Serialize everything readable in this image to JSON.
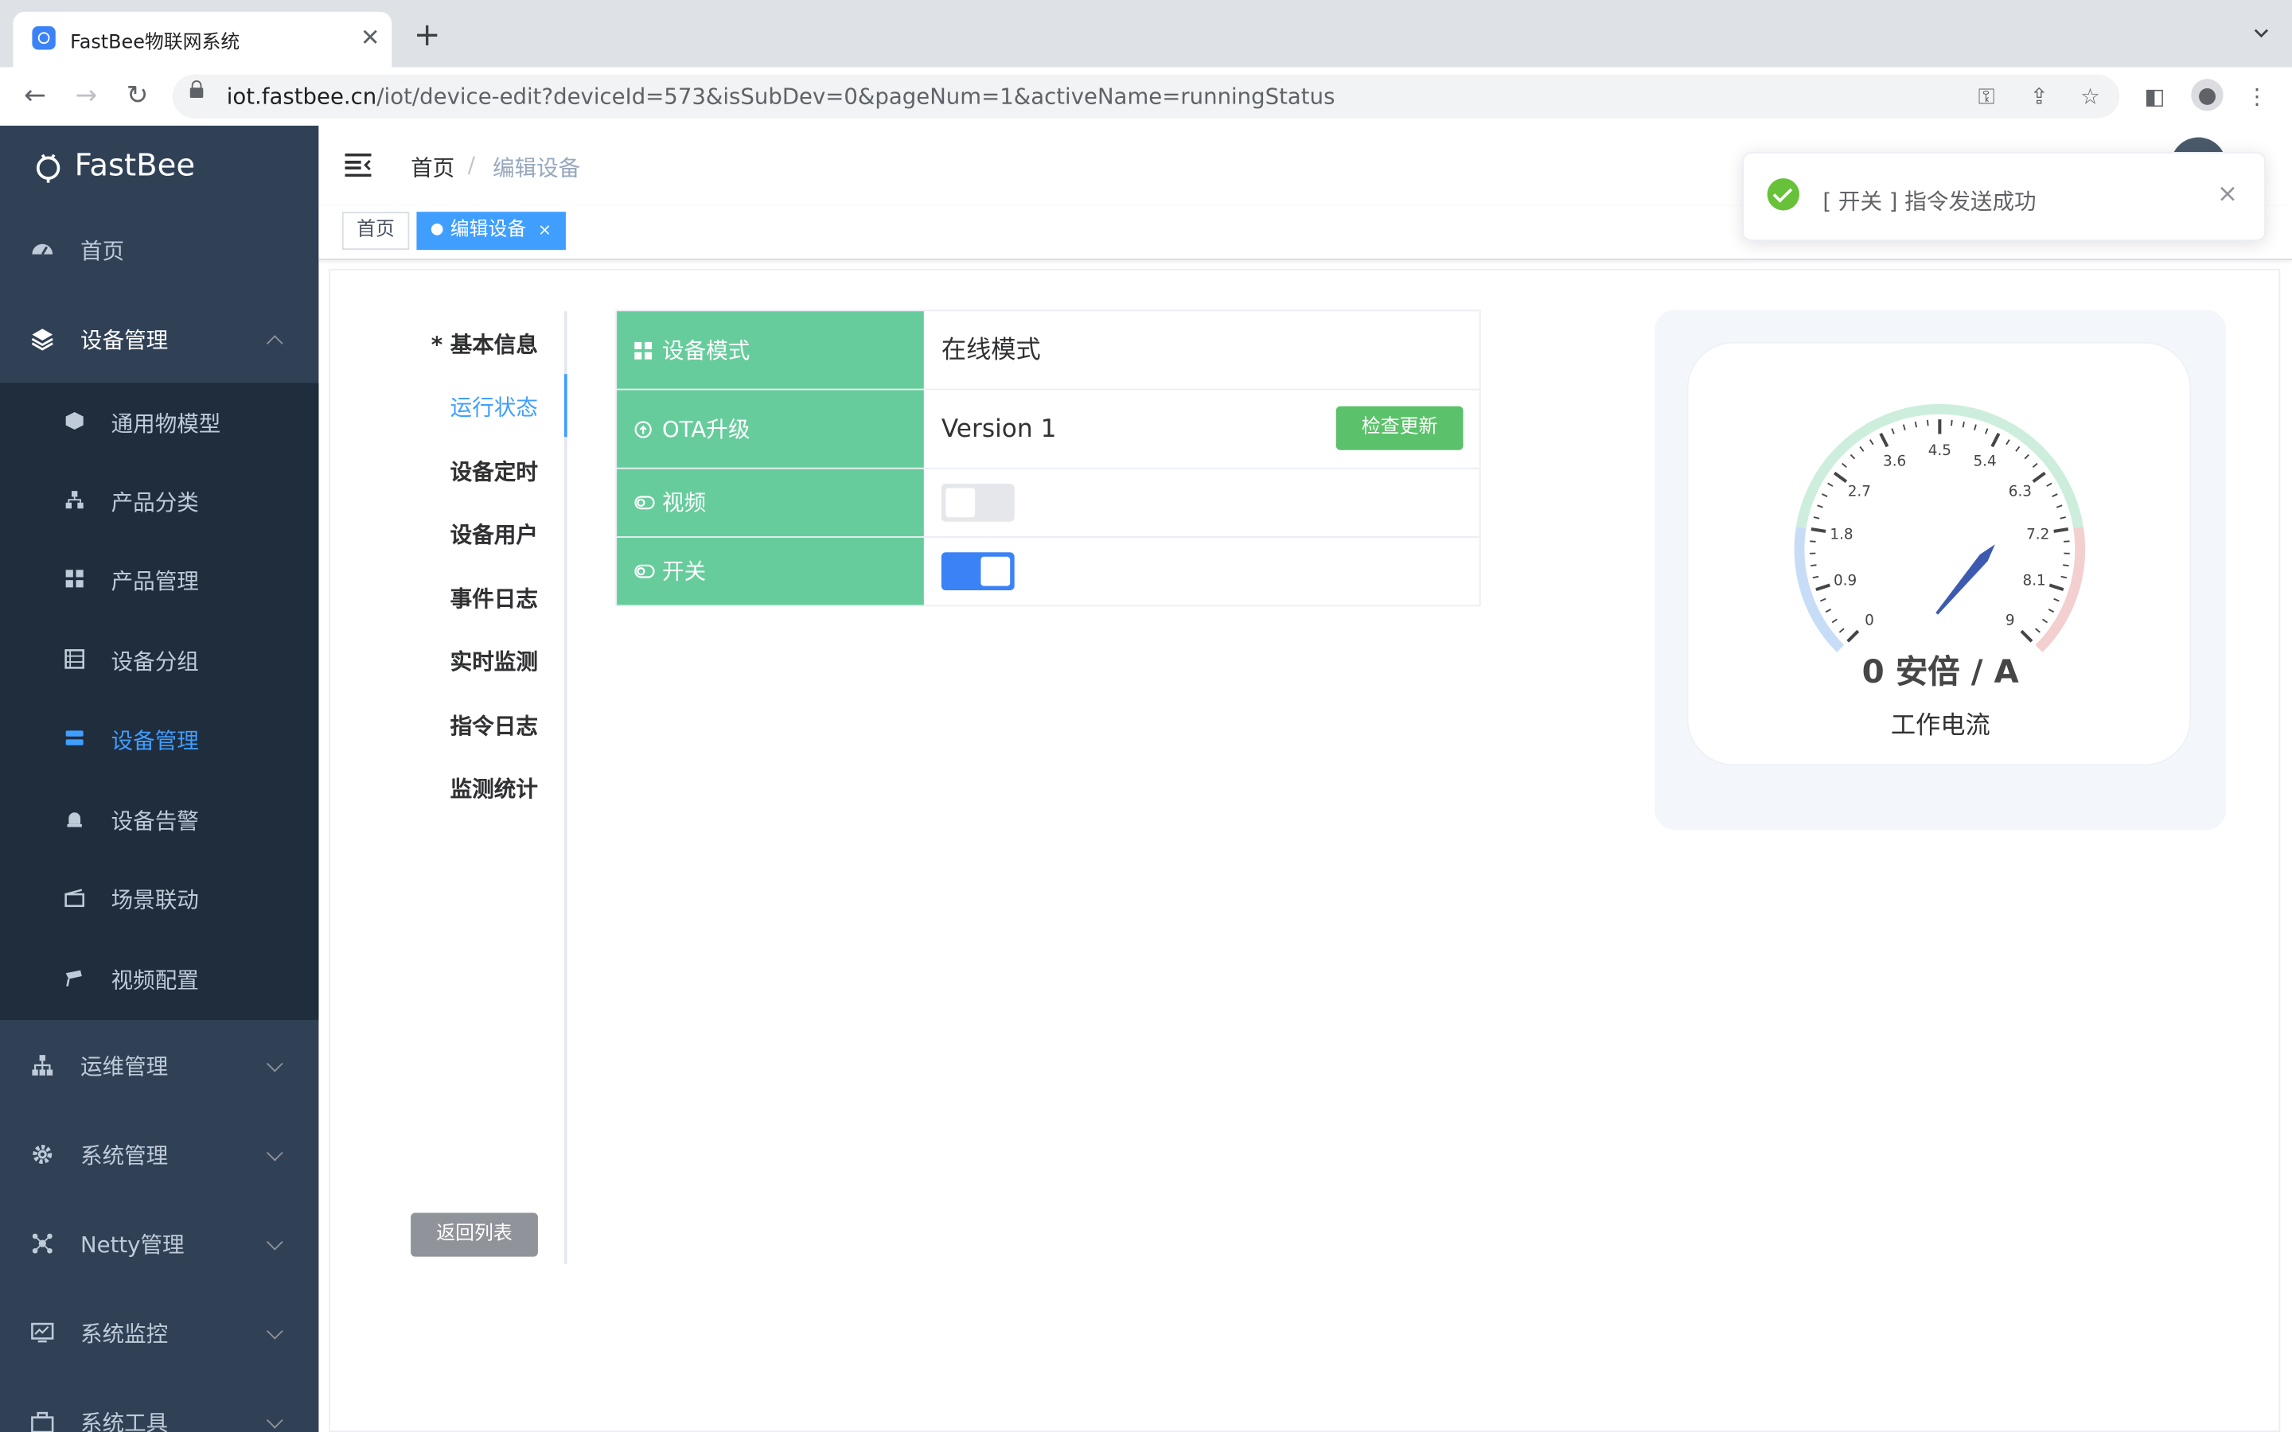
{
  "browser": {
    "tab_title": "FastBee物联网系统",
    "url_host": "iot.fastbee.cn",
    "url_path": "/iot/device-edit?deviceId=573&isSubDev=0&pageNum=1&activeName=runningStatus"
  },
  "sidebar": {
    "logo": "FastBee",
    "items": [
      {
        "label": "首页",
        "icon": "dashboard-icon"
      },
      {
        "label": "设备管理",
        "icon": "layers-icon",
        "expanded": true
      },
      {
        "label": "运维管理",
        "icon": "org-tree-icon"
      },
      {
        "label": "系统管理",
        "icon": "gear-icon"
      },
      {
        "label": "Netty管理",
        "icon": "network-icon"
      },
      {
        "label": "系统监控",
        "icon": "monitor-icon"
      },
      {
        "label": "系统工具",
        "icon": "toolbox-icon"
      }
    ],
    "submenu": [
      {
        "label": "通用物模型",
        "icon": "cube-icon"
      },
      {
        "label": "产品分类",
        "icon": "tree-icon"
      },
      {
        "label": "产品管理",
        "icon": "grid-icon"
      },
      {
        "label": "设备分组",
        "icon": "list-icon"
      },
      {
        "label": "设备管理",
        "icon": "server-icon",
        "active": true
      },
      {
        "label": "设备告警",
        "icon": "alarm-icon"
      },
      {
        "label": "场景联动",
        "icon": "clapper-icon"
      },
      {
        "label": "视频配置",
        "icon": "camera-icon"
      }
    ]
  },
  "header": {
    "breadcrumb": [
      "首页",
      "编辑设备"
    ],
    "breadcrumb_sep": "/"
  },
  "tags": {
    "home": "首页",
    "active": "编辑设备",
    "close": "×"
  },
  "vtabs": {
    "items": [
      "* 基本信息",
      "运行状态",
      "设备定时",
      "设备用户",
      "事件日志",
      "实时监测",
      "指令日志",
      "监测统计"
    ],
    "active_index": 1,
    "back_button": "返回列表"
  },
  "status": {
    "rows": [
      {
        "label": "设备模式",
        "icon": "grid-icon",
        "value": "在线模式"
      },
      {
        "label": "OTA升级",
        "icon": "upload-icon",
        "value": "Version 1",
        "button": "检查更新"
      },
      {
        "label": "视频",
        "icon": "toggle-icon",
        "switch": false
      },
      {
        "label": "开关",
        "icon": "toggle-icon",
        "switch": true
      }
    ]
  },
  "gauge": {
    "value": 0,
    "min": 0,
    "max": 9,
    "ticks": [
      "0",
      "0.9",
      "1.8",
      "2.7",
      "3.6",
      "4.5",
      "5.4",
      "6.3",
      "7.2",
      "8.1",
      "9"
    ],
    "value_text": "0 安倍 / A",
    "name": "工作电流",
    "colors": {
      "low": "#c7ddf7",
      "mid": "#cdeedc",
      "high": "#f4cfcf",
      "pointer": "#3c5bb0"
    }
  },
  "toast": {
    "message": "[ 开关 ] 指令发送成功",
    "close": "×"
  },
  "colors": {
    "sidebar_bg": "#304156",
    "submenu_bg": "#1f2d3d",
    "accent": "#409eff",
    "label_green": "#67cc9c",
    "button_green": "#5cc16b",
    "success": "#67c23a"
  }
}
